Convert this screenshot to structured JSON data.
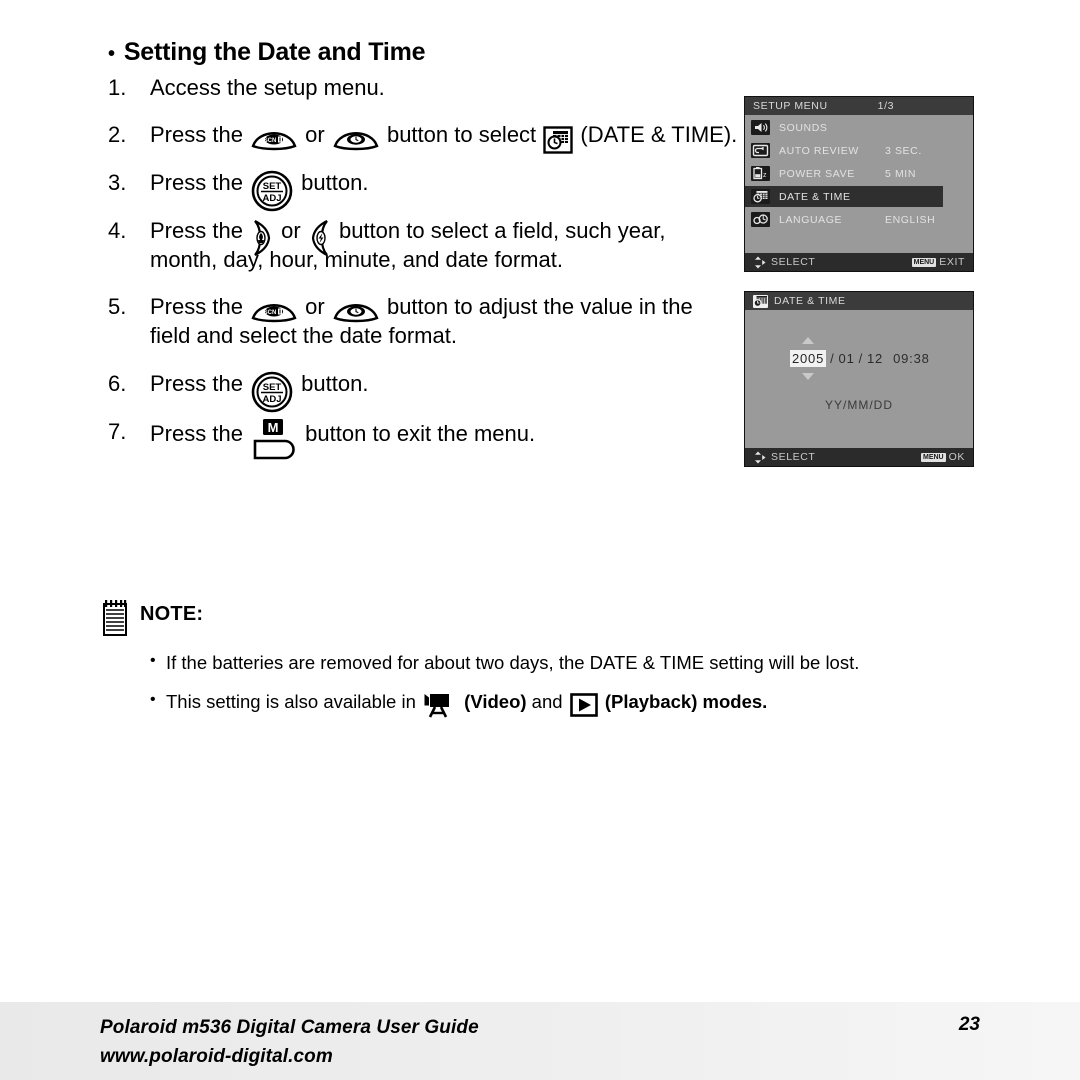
{
  "page": {
    "heading": "Setting the Date and Time",
    "heading_bullet": "•",
    "number": "23"
  },
  "steps": [
    {
      "num": "1.",
      "parts": [
        {
          "type": "text",
          "value": "Access the setup menu."
        }
      ]
    },
    {
      "num": "2.",
      "parts": [
        {
          "type": "text",
          "value": "Press the "
        },
        {
          "type": "icon",
          "icon": "scn-rocker-button"
        },
        {
          "type": "text",
          "value": " or "
        },
        {
          "type": "icon",
          "icon": "self-timer-rocker-button"
        },
        {
          "type": "text",
          "value": " button to select "
        },
        {
          "type": "icon",
          "icon": "date-time-icon"
        },
        {
          "type": "text",
          "value": " (DATE & TIME)."
        }
      ]
    },
    {
      "num": "3.",
      "parts": [
        {
          "type": "text",
          "value": "Press the "
        },
        {
          "type": "icon",
          "icon": "set-adj-button"
        },
        {
          "type": "text",
          "value": " button."
        }
      ]
    },
    {
      "num": "4.",
      "parts": [
        {
          "type": "text",
          "value": "Press the "
        },
        {
          "type": "icon",
          "icon": "macro-left-button"
        },
        {
          "type": "text",
          "value": " or "
        },
        {
          "type": "icon",
          "icon": "flash-right-button"
        },
        {
          "type": "text",
          "value": " button to select a field, such year, month, day, hour, minute, and date format."
        }
      ]
    },
    {
      "num": "5.",
      "parts": [
        {
          "type": "text",
          "value": "Press the "
        },
        {
          "type": "icon",
          "icon": "scn-rocker-button"
        },
        {
          "type": "text",
          "value": " or "
        },
        {
          "type": "icon",
          "icon": "self-timer-rocker-button"
        },
        {
          "type": "text",
          "value": " button to adjust the value in the field and select the date format."
        }
      ]
    },
    {
      "num": "6.",
      "parts": [
        {
          "type": "text",
          "value": "Press the "
        },
        {
          "type": "icon",
          "icon": "set-adj-button"
        },
        {
          "type": "text",
          "value": " button."
        }
      ]
    },
    {
      "num": "7.",
      "parts": [
        {
          "type": "text",
          "value": "Press the "
        },
        {
          "type": "icon",
          "icon": "menu-m-button"
        },
        {
          "type": "text",
          "value": " button to exit the menu."
        }
      ]
    }
  ],
  "note": {
    "title": "NOTE:",
    "icon": "notepad-icon",
    "items": [
      {
        "parts": [
          {
            "type": "text",
            "value": "If the batteries are removed for about two days, the DATE & TIME setting will be lost."
          }
        ]
      },
      {
        "parts": [
          {
            "type": "text",
            "value": "This setting is also available in "
          },
          {
            "type": "icon",
            "icon": "video-mode-icon"
          },
          {
            "type": "bold",
            "value": " (Video)"
          },
          {
            "type": "text",
            "value": " and "
          },
          {
            "type": "icon",
            "icon": "playback-mode-icon"
          },
          {
            "type": "bold",
            "value": " (Playback) modes."
          }
        ]
      }
    ]
  },
  "lcd_setup": {
    "title": "SETUP MENU",
    "page_indicator": "1/3",
    "rows": [
      {
        "icon": "sounds-icon",
        "label": "SOUNDS",
        "value": "",
        "selected": false
      },
      {
        "icon": "auto-review-icon",
        "label": "AUTO REVIEW",
        "value": "3 SEC.",
        "selected": false
      },
      {
        "icon": "power-save-icon",
        "label": "POWER SAVE",
        "value": "5 MIN",
        "selected": false
      },
      {
        "icon": "date-time-icon",
        "label": "DATE & TIME",
        "value": "",
        "selected": true
      },
      {
        "icon": "language-icon",
        "label": "LANGUAGE",
        "value": "ENGLISH",
        "selected": false
      }
    ],
    "footer_left": "SELECT",
    "footer_badge": "MENU",
    "footer_right": "EXIT"
  },
  "lcd_datetime": {
    "title": "DATE & TIME",
    "title_icon": "date-time-icon",
    "year": "2005",
    "sep1": "/",
    "month": "01",
    "sep2": "/",
    "day": "12",
    "time": "09:38",
    "format": "YY/MM/DD",
    "footer_left": "SELECT",
    "footer_badge": "MENU",
    "footer_right": "OK"
  },
  "footer": {
    "line1": "Polaroid m536 Digital Camera User Guide",
    "line2": "www.polaroid-digital.com",
    "page_number": "23"
  },
  "colors": {
    "lcd_background": "#9a9a9a",
    "lcd_titlebar": "#3b3b3b",
    "lcd_footer": "#2b2b2b",
    "lcd_selected_row": "#2f2f2f",
    "lcd_text": "#e2e2e2",
    "page_background": "#ffffff",
    "footer_band": "#eeeeee"
  }
}
